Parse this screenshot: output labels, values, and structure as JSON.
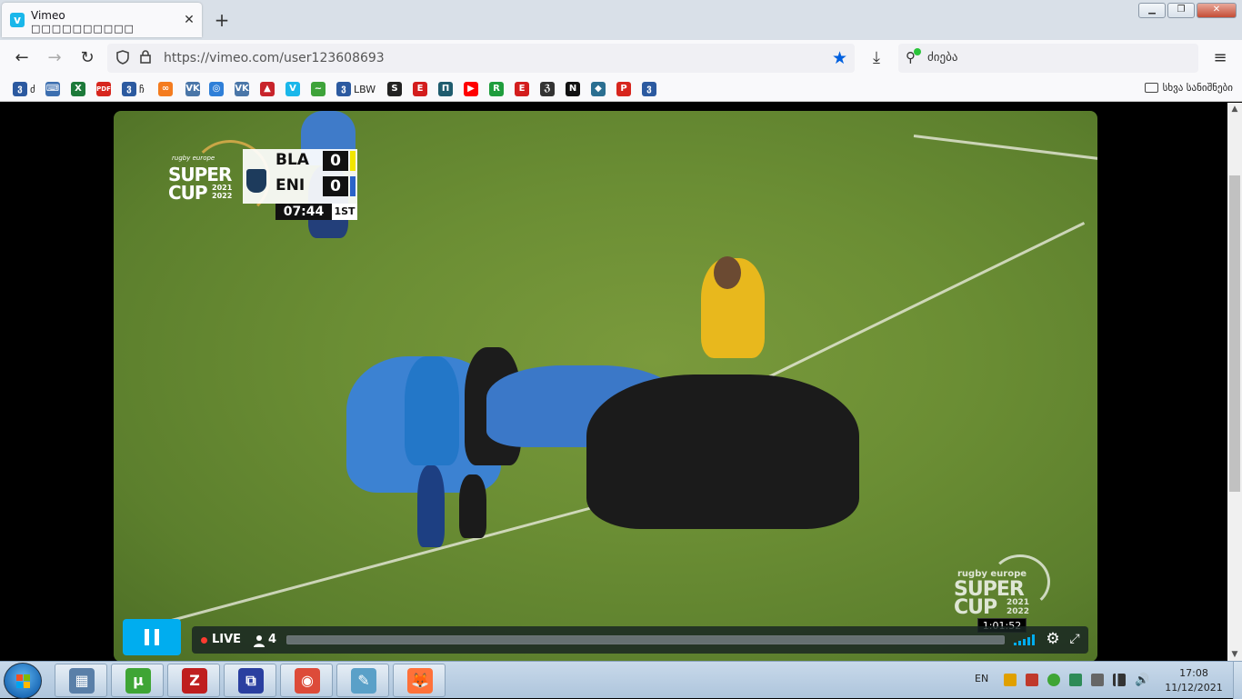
{
  "browser": {
    "tab": {
      "favicon": "vimeo-icon",
      "title": "Vimeo",
      "subtitle": "□□□□□□□□□□"
    },
    "url": "https://vimeo.com/user123608693",
    "search_placeholder": "ძიება",
    "bookmarks": [
      {
        "icon": "georgian-site-icon",
        "color": "#2c5aa0",
        "glyph": "ვ",
        "label": "ძ"
      },
      {
        "icon": "chat-icon",
        "color": "#3d6fb0",
        "glyph": "⌨",
        "label": ""
      },
      {
        "icon": "excel-icon",
        "color": "#1d7a3a",
        "glyph": "X",
        "label": ""
      },
      {
        "icon": "pdf-icon",
        "color": "#d7261e",
        "glyph": "PDF",
        "label": ""
      },
      {
        "icon": "georgian-site-icon",
        "color": "#2c5aa0",
        "glyph": "ვ",
        "label": "ჩ"
      },
      {
        "icon": "orange-link-icon",
        "color": "#f47c20",
        "glyph": "∞",
        "label": ""
      },
      {
        "icon": "vk-icon",
        "color": "#4a76a8",
        "glyph": "VK",
        "label": ""
      },
      {
        "icon": "blue-ring-icon",
        "color": "#2f7fd8",
        "glyph": "◎",
        "label": ""
      },
      {
        "icon": "vk-icon",
        "color": "#4a76a8",
        "glyph": "VK",
        "label": ""
      },
      {
        "icon": "red-bird-icon",
        "color": "#c8242b",
        "glyph": "▲",
        "label": ""
      },
      {
        "icon": "vimeo-icon",
        "color": "#1ab7ea",
        "glyph": "V",
        "label": ""
      },
      {
        "icon": "green-curve-icon",
        "color": "#3ea33a",
        "glyph": "~",
        "label": ""
      },
      {
        "icon": "georgian-site-icon",
        "color": "#2c5aa0",
        "glyph": "ვ",
        "label": "LBW"
      },
      {
        "icon": "s-circle-icon",
        "color": "#222222",
        "glyph": "S",
        "label": ""
      },
      {
        "icon": "red-e-icon",
        "color": "#d31d1d",
        "glyph": "E",
        "label": ""
      },
      {
        "icon": "teal-square-icon",
        "color": "#1f5c6e",
        "glyph": "П",
        "label": ""
      },
      {
        "icon": "youtube-icon",
        "color": "#ff0000",
        "glyph": "▶",
        "label": ""
      },
      {
        "icon": "green-r-icon",
        "color": "#1f9d3d",
        "glyph": "R",
        "label": ""
      },
      {
        "icon": "red-e-icon",
        "color": "#d31d1d",
        "glyph": "E",
        "label": ""
      },
      {
        "icon": "gothic-logo-icon",
        "color": "#333333",
        "glyph": "ℨ",
        "label": ""
      },
      {
        "icon": "news-icon",
        "color": "#111111",
        "glyph": "N",
        "label": ""
      },
      {
        "icon": "rugby-icon",
        "color": "#2b6f91",
        "glyph": "◆",
        "label": ""
      },
      {
        "icon": "pdf-small-icon",
        "color": "#d7261e",
        "glyph": "P",
        "label": ""
      },
      {
        "icon": "georgian-site-icon",
        "color": "#2c5aa0",
        "glyph": "ვ",
        "label": ""
      }
    ],
    "other_bookmarks": "სხვა სანიშნები"
  },
  "scoreboard": {
    "logo_small": "rugby europe",
    "logo_super": "SUPER",
    "logo_cup": "CUP",
    "logo_years": [
      "2021",
      "2022"
    ],
    "home_team": "BLA",
    "home_score": "0",
    "away_team": "ENI",
    "away_score": "0",
    "clock": "07:44",
    "period": "1ST",
    "home_color": "#f2e600",
    "away_color": "#2b63c9"
  },
  "watermark": {
    "small": "rugby europe",
    "super": "SUPER",
    "cup": "CUP",
    "years": [
      "2021",
      "2022"
    ]
  },
  "player": {
    "state": "playing",
    "live_label": "LIVE",
    "viewers": "4",
    "hover_time": "1:01:52",
    "progress": 1.0,
    "accent": "#00adef"
  },
  "taskbar": {
    "apps": [
      {
        "icon": "calculator-icon",
        "color": "#5a7fa8",
        "glyph": "▦"
      },
      {
        "icon": "utorrent-icon",
        "color": "#3fa535",
        "glyph": "µ"
      },
      {
        "icon": "filezilla-icon",
        "color": "#bf1e1e",
        "glyph": "Z"
      },
      {
        "icon": "remote-app-icon",
        "color": "#2a3fa0",
        "glyph": "⧉"
      },
      {
        "icon": "chrome-icon",
        "color": "#dd4b39",
        "glyph": "◉"
      },
      {
        "icon": "notepad-icon",
        "color": "#5aa0c8",
        "glyph": "✎"
      },
      {
        "icon": "firefox-icon",
        "color": "#ff7139",
        "glyph": "🦊"
      }
    ],
    "language": "EN",
    "time": "17:08",
    "date": "11/12/2021"
  }
}
